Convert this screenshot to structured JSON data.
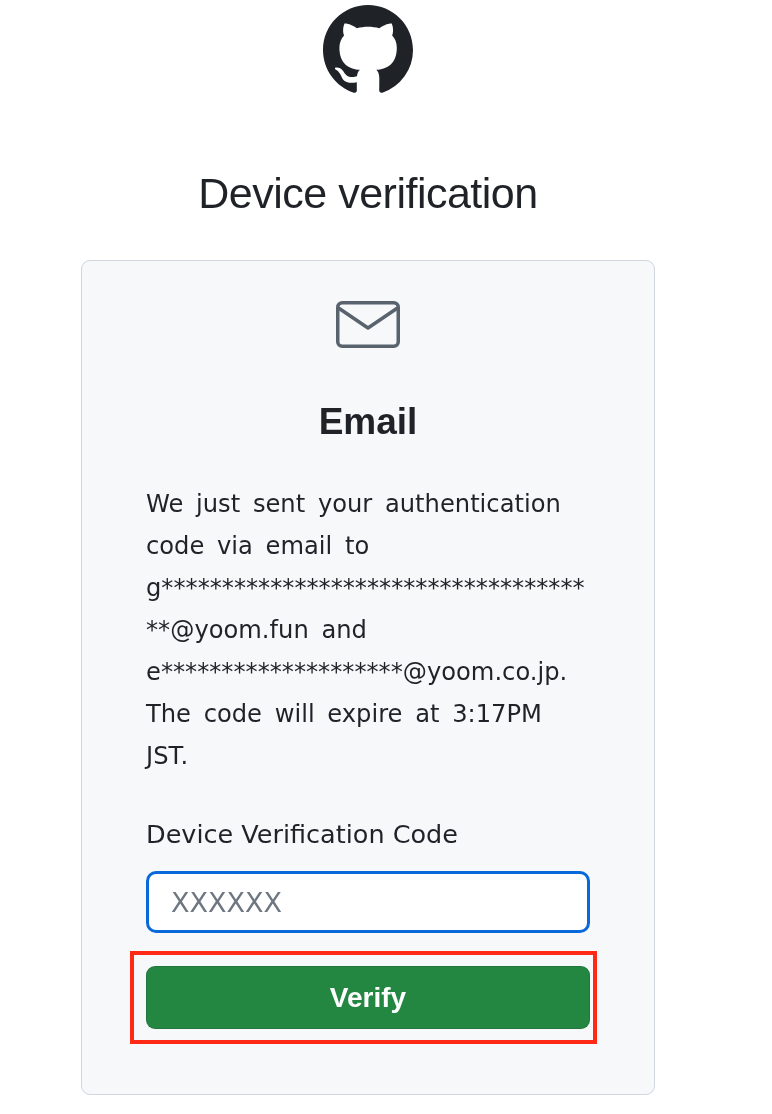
{
  "title": "Device verification",
  "card": {
    "heading": "Email",
    "message": "We just sent your authentication code via email to g*************************************@yoom.fun and e********************@yoom.co.jp. The code will expire at 3:17PM JST.",
    "field": {
      "label": "Device Verification Code",
      "placeholder": "XXXXXX",
      "focused": true
    },
    "button": {
      "label": "Verify",
      "highlighted": true
    }
  }
}
